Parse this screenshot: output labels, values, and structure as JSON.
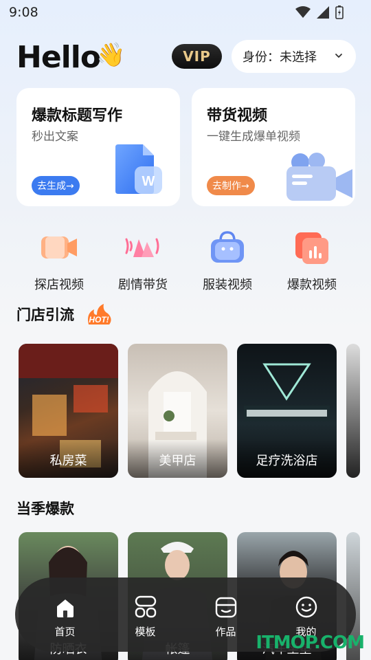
{
  "status_bar": {
    "time": "9:08"
  },
  "header": {
    "greeting": "Hello",
    "wave_emoji": "👋",
    "vip_label": "VIP",
    "identity_label": "身份：未选择"
  },
  "feature_cards": [
    {
      "title": "爆款标题写作",
      "subtitle": "秒出文案",
      "button": "去生成→",
      "icon": "document-w-icon",
      "accent": "#3c7bf0"
    },
    {
      "title": "带货视频",
      "subtitle": "一键生成爆单视频",
      "button": "去制作→",
      "icon": "video-camera-icon",
      "accent": "#f08a4a"
    }
  ],
  "categories": [
    {
      "label": "探店视频",
      "icon": "video-camera-icon"
    },
    {
      "label": "剧情带货",
      "icon": "megaphone-icon"
    },
    {
      "label": "服装视频",
      "icon": "shopping-bag-icon"
    },
    {
      "label": "爆款视频",
      "icon": "chart-card-icon"
    }
  ],
  "store_section": {
    "title": "门店引流",
    "badge": "HOT!",
    "tiles": [
      {
        "label": "私房菜"
      },
      {
        "label": "美甲店"
      },
      {
        "label": "足疗洗浴店"
      }
    ]
  },
  "season_section": {
    "title": "当季爆款",
    "tiles": [
      {
        "label": "防晒衣"
      },
      {
        "label": "帐篷"
      },
      {
        "label": "汽车坐垫"
      }
    ]
  },
  "bottom_nav": [
    {
      "label": "首页",
      "icon": "home-icon",
      "active": true
    },
    {
      "label": "模板",
      "icon": "template-icon",
      "active": false
    },
    {
      "label": "作品",
      "icon": "works-icon",
      "active": false
    },
    {
      "label": "我的",
      "icon": "smile-icon",
      "active": false
    }
  ],
  "watermark": "ITMOP.COM"
}
